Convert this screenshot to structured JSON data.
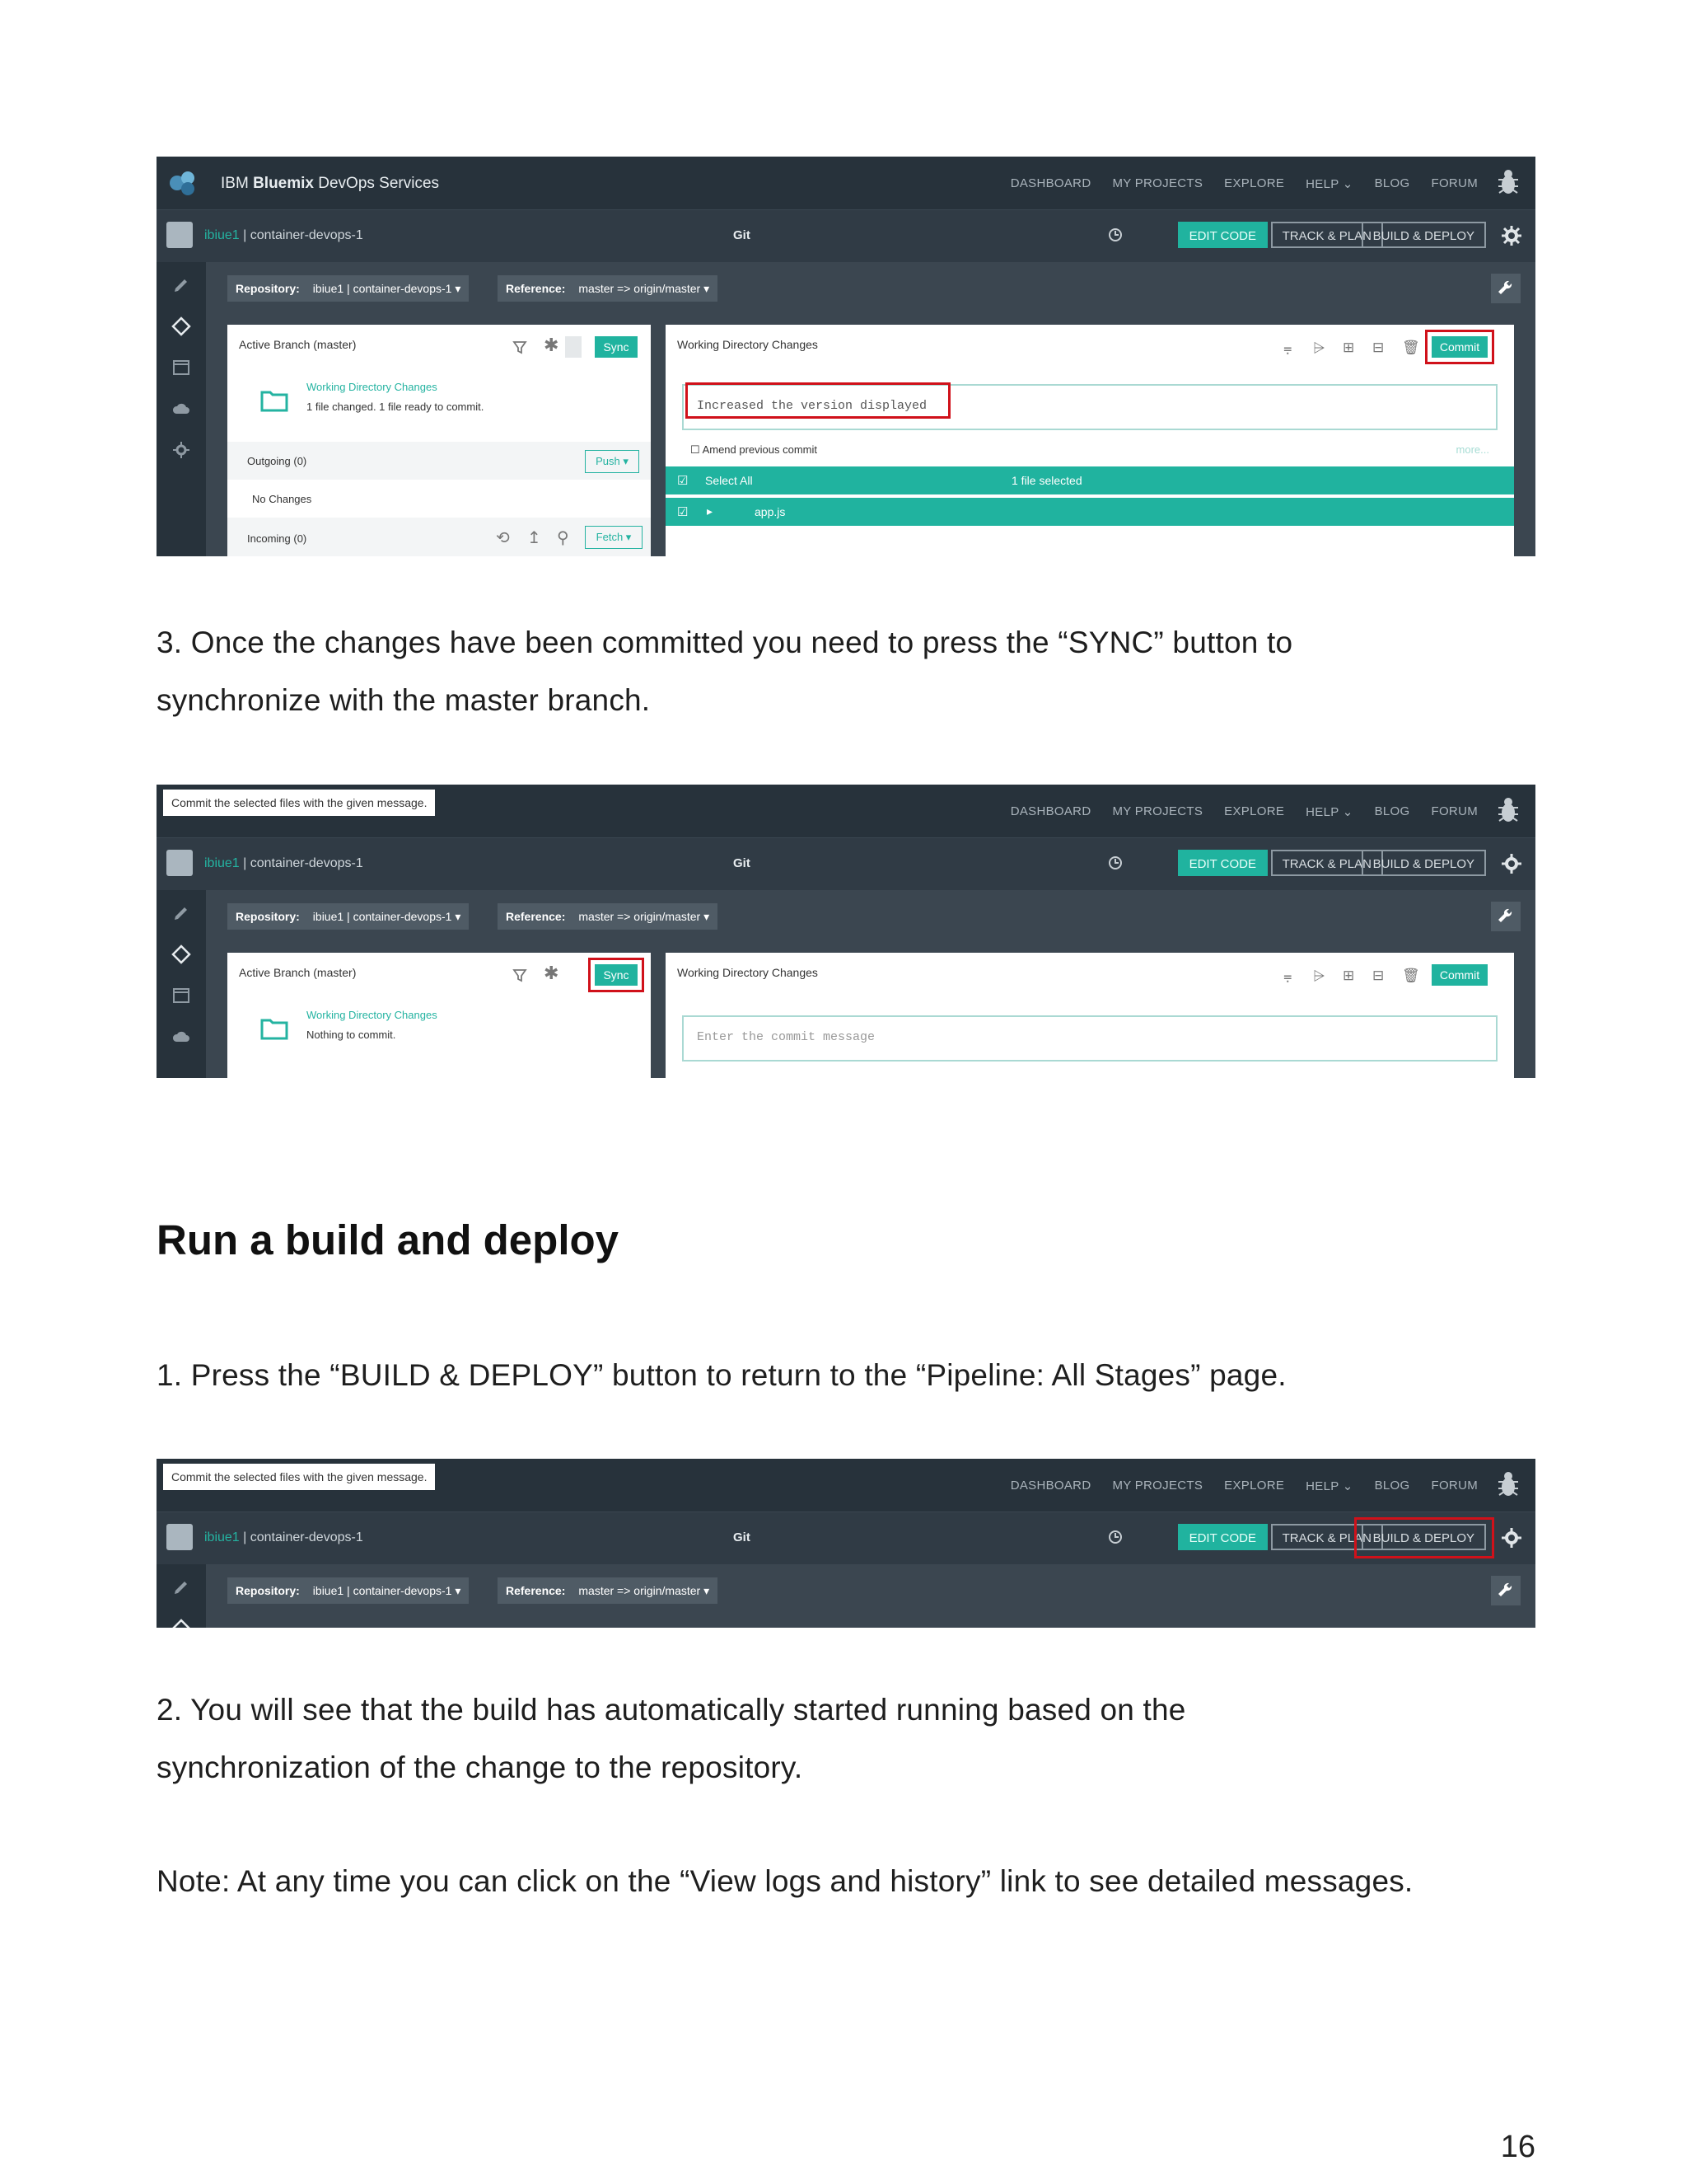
{
  "app": {
    "brand_prefix": "IBM",
    "brand_bold": "Bluemix",
    "brand_suffix": "DevOps Services",
    "nav": [
      "DASHBOARD",
      "MY PROJECTS",
      "EXPLORE",
      "HELP",
      "BLOG",
      "FORUM"
    ],
    "project_user": "ibiue1",
    "project_sep": " | ",
    "project_name": "container-devops-1",
    "section_title": "Git",
    "buttons": {
      "edit": "EDIT CODE",
      "track": "TRACK & PLAN",
      "build": "BUILD & DEPLOY"
    },
    "repository_label": "Repository:",
    "repository_value": "ibiue1 | container-devops-1",
    "reference_label": "Reference:",
    "reference_value": "master => origin/master",
    "active_branch": "Active Branch (master)",
    "sync_label": "Sync",
    "wdc_title": "Working Directory Changes",
    "commit_label": "Commit",
    "tooltip": "Commit the selected files with the given message."
  },
  "shot1": {
    "wdc_link": "Working Directory Changes",
    "wdc_status": "1 file changed. 1 file ready to commit.",
    "outgoing": "Outgoing (0)",
    "push": "Push",
    "no_changes": "No Changes",
    "incoming": "Incoming (0)",
    "fetch": "Fetch",
    "commit_message": "Increased the version displayed",
    "amend": "Amend previous commit",
    "more": "more...",
    "select_all": "Select All",
    "files_selected": "1 file selected",
    "file": "app.js"
  },
  "shot2": {
    "wdc_link": "Working Directory Changes",
    "wdc_status": "Nothing to commit.",
    "commit_placeholder": "Enter the commit message"
  },
  "text": {
    "step3": "3. Once the changes have been committed you need to press the “SYNC” button to synchronize with the master branch.",
    "heading": "Run a build and deploy",
    "step1": "1. Press the “BUILD & DEPLOY” button to return to the “Pipeline: All Stages” page.",
    "step2": "2. You will see that the build has automatically started running based on the synchronization of the change to the repository.",
    "note": "Note: At any time you can click on the “View logs and history” link to see detailed messages.",
    "page_number": "16"
  }
}
